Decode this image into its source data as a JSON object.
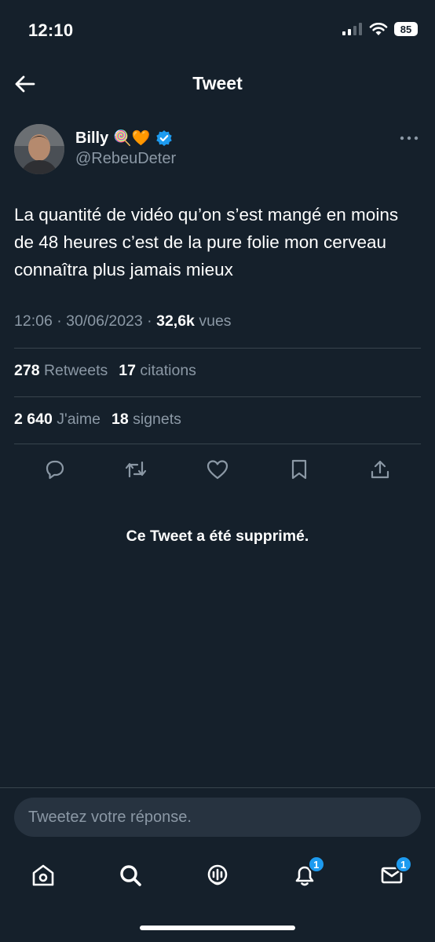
{
  "status_bar": {
    "time": "12:10",
    "battery": "85"
  },
  "header": {
    "title": "Tweet"
  },
  "author": {
    "name": "Billy",
    "handle": "@RebeuDeter",
    "emoji": "🍭🧡"
  },
  "tweet": {
    "text": "La quantité de vidéo qu’on s’est mangé en moins de 48 heures c’est de la pure folie mon cerveau connaîtra plus jamais mieux",
    "time": "12:06",
    "date": "30/06/2023",
    "views_count": "32,6k",
    "views_label": "vues"
  },
  "stats": {
    "retweets_count": "278",
    "retweets_label": "Retweets",
    "quotes_count": "17",
    "quotes_label": "citations",
    "likes_count": "2 640",
    "likes_label": "J'aime",
    "bookmarks_count": "18",
    "bookmarks_label": "signets"
  },
  "deleted_notice": "Ce Tweet a été supprimé.",
  "reply": {
    "placeholder": "Tweetez votre réponse."
  },
  "tabbar": {
    "notifications_badge": "1",
    "messages_badge": "1"
  },
  "colors": {
    "background": "#15202b",
    "accent": "#1d9bf0",
    "muted": "#8b98a5"
  }
}
